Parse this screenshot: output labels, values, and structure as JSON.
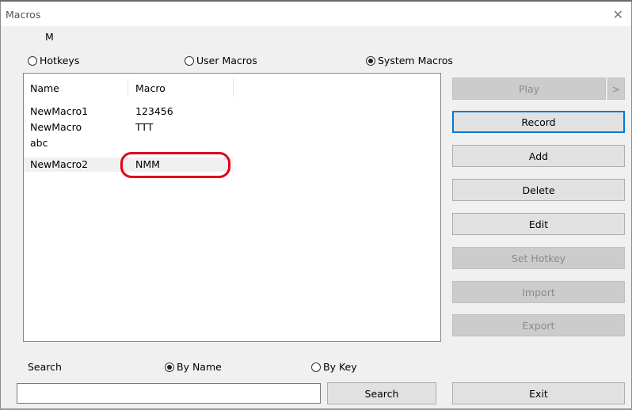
{
  "window": {
    "title": "Macros"
  },
  "header_label": "M",
  "mode_options": [
    {
      "label": "Hotkeys",
      "checked": false
    },
    {
      "label": "User Macros",
      "checked": false
    },
    {
      "label": "System Macros",
      "checked": true
    }
  ],
  "list": {
    "columns": [
      "Name",
      "Macro"
    ],
    "rows": [
      {
        "name": "NewMacro1",
        "macro": "123456",
        "selected": false
      },
      {
        "name": "NewMacro",
        "macro": "TTT",
        "selected": false
      },
      {
        "name": "abc",
        "macro": "",
        "selected": false
      },
      {
        "name": "NewMacro2",
        "macro": "NMM",
        "selected": true
      }
    ],
    "highlight_color": "#e0001a"
  },
  "buttons": {
    "play": "Play",
    "play_more": ">",
    "record": "Record",
    "add": "Add",
    "delete": "Delete",
    "edit": "Edit",
    "set_hotkey": "Set Hotkey",
    "import": "Import",
    "export": "Export",
    "exit": "Exit"
  },
  "search": {
    "label": "Search",
    "by_options": [
      {
        "label": "By Name",
        "checked": true
      },
      {
        "label": "By Key",
        "checked": false
      }
    ],
    "value": "",
    "button": "Search"
  },
  "colors": {
    "focus": "#0078d7",
    "disabled_button": "#cccccc",
    "button": "#e1e1e1"
  }
}
